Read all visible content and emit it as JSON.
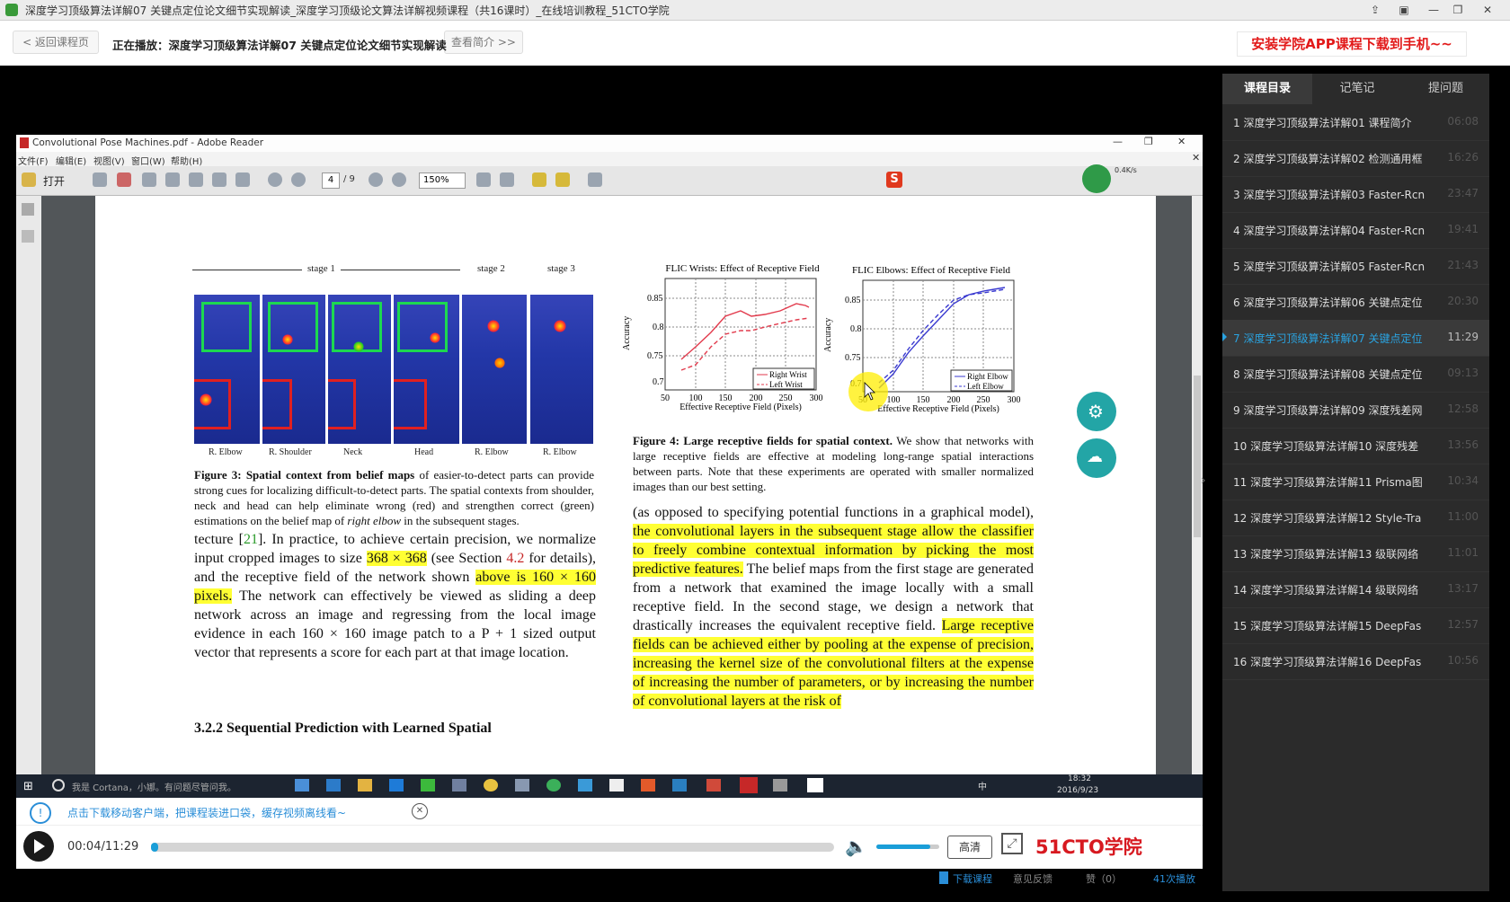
{
  "window": {
    "title": "深度学习顶级算法详解07  关键点定位论文细节实现解读_深度学习顶级论文算法详解视频课程（共16课时）_在线培训教程_51CTO学院"
  },
  "nav": {
    "back_label": "< 返回课程页",
    "now_playing": "正在播放：深度学习顶级算法详解07  关键点定位论文细节实现解读",
    "intro_label": "查看简介 >>",
    "promo": "安装学院APP课程下载到手机~~"
  },
  "adobe": {
    "title": "Convolutional Pose Machines.pdf - Adobe Reader",
    "menu": [
      "文件(F)",
      "编辑(E)",
      "视图(V)",
      "窗口(W)",
      "帮助(H)"
    ],
    "open_label": "打开",
    "page_current": "4",
    "page_total": "/ 9",
    "zoom": "150%"
  },
  "pdf": {
    "fig3": {
      "stage1": "stage 1",
      "stage2": "stage 2",
      "stage3": "stage 3",
      "labels": [
        "R. Elbow",
        "R. Shoulder",
        "Neck",
        "Head",
        "R. Elbow",
        "R. Elbow"
      ],
      "caption_bold": "Figure 3: Spatial context from belief maps",
      "caption_1": " of easier-to-detect parts can provide strong cues for localizing difficult-to-detect parts. The spatial contexts from shoulder, neck and head can help eliminate wrong (red) and strengthen correct (green) estimations on the belief map of ",
      "caption_ital": "right elbow",
      "caption_2": " in the subsequent stages."
    },
    "fig4": {
      "chart1_title": "FLIC Wrists: Effect of Receptive Field",
      "chart2_title": "FLIC Elbows: Effect of Receptive Field",
      "ylabel": "Accuracy",
      "xlabel": "Effective Receptive Field (Pixels)",
      "yticks": [
        "0.85",
        "0.8",
        "0.75",
        "0.7"
      ],
      "xticks": [
        "50",
        "100",
        "150",
        "200",
        "250",
        "300"
      ],
      "legend1": [
        "Right Wrist",
        "Left Wrist"
      ],
      "legend2": [
        "Right Elbow",
        "Left Elbow"
      ],
      "caption_bold": "Figure 4: Large receptive fields for spatial context.",
      "caption_rest": " We show that networks with large receptive fields are effective at modeling long-range spatial interactions between parts. Note that these experiments are operated with smaller normalized images than our best setting."
    },
    "left_para": {
      "p1": "tecture [",
      "ref": "21",
      "p2": "]. In practice, to achieve certain precision, we normalize input cropped images to size ",
      "hl1": "368 × 368",
      "p3": " (see Section ",
      "sec": "4.2",
      "p4": " for details), and the receptive field of the network shown ",
      "hl2": "above is 160 × 160 pixels.",
      "p5": " The network can effectively be viewed as sliding a deep network across an image and regressing from the local image evidence in each 160 × 160 image patch to a P + 1 sized output vector that represents a score for each part at that image location."
    },
    "section_heading": "3.2.2   Sequential Prediction with Learned Spatial",
    "right_para": {
      "r1": "(as opposed to specifying potential functions in a graphical model), ",
      "hl1": "the convolutional layers in the subsequent stage allow the classifier to freely combine contextual information by picking the most predictive features.",
      "r2": " The belief maps from the first stage are generated from a network that examined the image locally with a small receptive field. In the second stage, we design a network that drastically increases the equivalent receptive field. ",
      "hl2": "Large receptive fields can be achieved either by pooling at the expense of precision, increasing the kernel size of the convolutional filters at the expense of increasing the number of parameters, or by increasing the number of convolutional layers at the risk of"
    }
  },
  "taskbar": {
    "cortana": "我是 Cortana，小娜。有问题尽管问我。",
    "ime": "中",
    "clock_time": "18:32",
    "clock_date": "2016/9/23",
    "net_speed": "0.4K/s"
  },
  "player": {
    "notice": "点击下载移动客户端，把课程装进口袋，缓存视频离线看~",
    "time": "00:04/11:29",
    "progress": 0.006,
    "volume": 0.85,
    "quality": "高清",
    "brand": "51CTO学院",
    "download": "下载课程",
    "feedback": "意见反馈",
    "like": "赞（0）",
    "plays": "41次播放"
  },
  "sidebar": {
    "tabs": [
      "课程目录",
      "记笔记",
      "提问题"
    ],
    "lessons": [
      {
        "title": "1 深度学习顶级算法详解01 课程简介",
        "dur": "06:08"
      },
      {
        "title": "2 深度学习顶级算法详解02 检测通用框",
        "dur": "16:26"
      },
      {
        "title": "3 深度学习顶级算法详解03 Faster-Rcn",
        "dur": "23:47"
      },
      {
        "title": "4 深度学习顶级算法详解04 Faster-Rcn",
        "dur": "19:41"
      },
      {
        "title": "5 深度学习顶级算法详解05 Faster-Rcn",
        "dur": "21:43"
      },
      {
        "title": "6 深度学习顶级算法详解06 关键点定位",
        "dur": "20:30"
      },
      {
        "title": "7 深度学习顶级算法详解07 关键点定位",
        "dur": "11:29"
      },
      {
        "title": "8 深度学习顶级算法详解08 关键点定位",
        "dur": "09:13"
      },
      {
        "title": "9 深度学习顶级算法详解09 深度残差网",
        "dur": "12:58"
      },
      {
        "title": "10 深度学习顶级算法详解10 深度残差",
        "dur": "13:56"
      },
      {
        "title": "11 深度学习顶级算法详解11 Prisma图",
        "dur": "10:34"
      },
      {
        "title": "12 深度学习顶级算法详解12 Style-Tra",
        "dur": "11:00"
      },
      {
        "title": "13 深度学习顶级算法详解13 级联网络",
        "dur": "11:01"
      },
      {
        "title": "14 深度学习顶级算法详解14 级联网络",
        "dur": "13:17"
      },
      {
        "title": "15 深度学习顶级算法详解15 DeepFas",
        "dur": "12:57"
      },
      {
        "title": "16 深度学习顶级算法详解16 DeepFas",
        "dur": "10:56"
      }
    ]
  },
  "colors": {
    "accent": "#2aa3e0",
    "promo": "#e21a1a",
    "highlight": "#ffff33",
    "fab": "#23a5a6",
    "brand": "#d71920"
  }
}
